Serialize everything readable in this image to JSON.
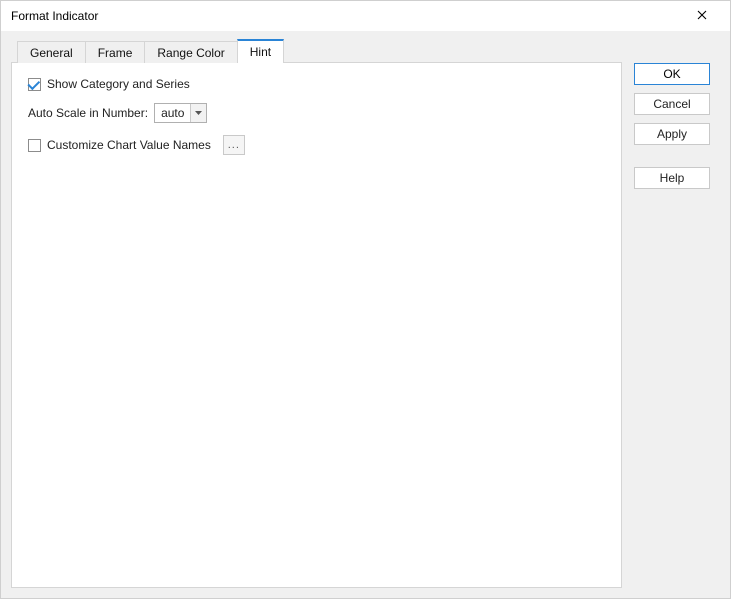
{
  "title": "Format Indicator",
  "tabs": {
    "general": "General",
    "frame": "Frame",
    "range_color": "Range Color",
    "hint": "Hint"
  },
  "active_tab": "hint",
  "hint_panel": {
    "show_category_label": "Show Category and Series",
    "show_category_checked": true,
    "auto_scale_label": "Auto Scale in Number:",
    "auto_scale_value": "auto",
    "customize_label": "Customize Chart Value Names",
    "customize_checked": false,
    "ellipsis_label": "..."
  },
  "buttons": {
    "ok": "OK",
    "cancel": "Cancel",
    "apply": "Apply",
    "help": "Help"
  }
}
